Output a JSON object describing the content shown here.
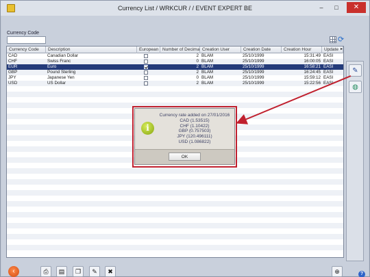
{
  "window": {
    "title": "Currency List / WRKCUR /  / EVENT EXPERT BE",
    "minimize_glyph": "–",
    "maximize_glyph": "□",
    "close_glyph": "✕"
  },
  "filter": {
    "label": "Currency Code",
    "value": ""
  },
  "table": {
    "columns": [
      "Currency Code",
      "Description",
      "European",
      "Number of Decimals",
      "Creation User",
      "Creation Date",
      "Creation Hour",
      "Update"
    ],
    "rows": [
      {
        "code": "CAD",
        "description": "Canadian Dollar",
        "european": false,
        "decimals": "2",
        "user": "BLAM",
        "date": "25/10/1999",
        "hour": "15:31:49",
        "update": "EASI"
      },
      {
        "code": "CHF",
        "description": "Swiss Franc",
        "european": false,
        "decimals": "0",
        "user": "BLAM",
        "date": "25/10/1999",
        "hour": "16:00:05",
        "update": "EASI"
      },
      {
        "code": "EUR",
        "description": "Euro",
        "european": true,
        "decimals": "2",
        "user": "BLAM",
        "date": "25/10/1999",
        "hour": "16:58:21",
        "update": "EASI",
        "selected": true
      },
      {
        "code": "GBP",
        "description": "Pound Sterling",
        "european": false,
        "decimals": "2",
        "user": "BLAM",
        "date": "25/10/1999",
        "hour": "16:24:45",
        "update": "EASI"
      },
      {
        "code": "JPY",
        "description": "Japanese Yen",
        "european": false,
        "decimals": "0",
        "user": "BLAM",
        "date": "25/10/1999",
        "hour": "15:59:12",
        "update": "EASI"
      },
      {
        "code": "USD",
        "description": "US Dollar",
        "european": false,
        "decimals": "2",
        "user": "BLAM",
        "date": "25/10/1999",
        "hour": "15:22:56",
        "update": "EASI"
      }
    ]
  },
  "dialog": {
    "lines": [
      "Currency rate added on 27/01/2016",
      "CAD (1.53515)",
      "CHF (1.10422)",
      "GBP (0.757503)",
      "JPY (120.496111)",
      "USD (1.086822)"
    ],
    "ok_label": "OK",
    "info_glyph": "i"
  },
  "icons": {
    "side": [
      "pen-icon",
      "globe-icon"
    ],
    "toolbar": [
      "back-icon",
      "print-icon",
      "document-icon",
      "copy-icon",
      "edit-icon",
      "delete-icon",
      "add-icon",
      "help-icon"
    ]
  },
  "colors": {
    "selected_row": "#243b7a",
    "highlight": "#c0202e"
  }
}
